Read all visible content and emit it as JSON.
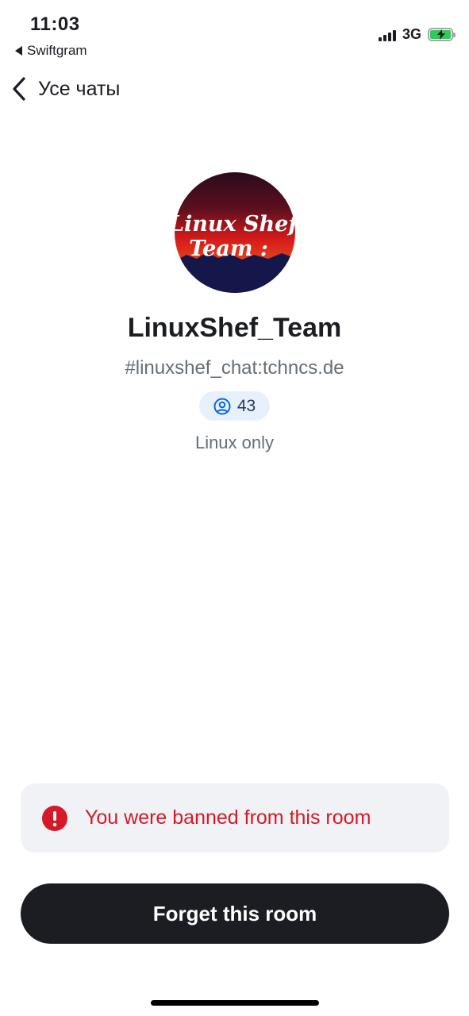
{
  "status_bar": {
    "time": "11:03",
    "back_app": "Swiftgram",
    "network": "3G",
    "battery_color": "#34c759"
  },
  "nav": {
    "back_label": "Усе чаты",
    "back_icon": "chevron-left-icon"
  },
  "room": {
    "avatar_text_line1": "Linux Shef",
    "avatar_text_line2": "Team :",
    "name": "LinuxShef_Team",
    "alias": "#linuxshef_chat:tchncs.de",
    "member_count": "43",
    "member_icon": "user-circle-icon",
    "topic": "Linux only"
  },
  "banner": {
    "icon": "error-icon",
    "message": "You were banned from this room",
    "color": "#d51928"
  },
  "actions": {
    "forget_label": "Forget this room"
  }
}
